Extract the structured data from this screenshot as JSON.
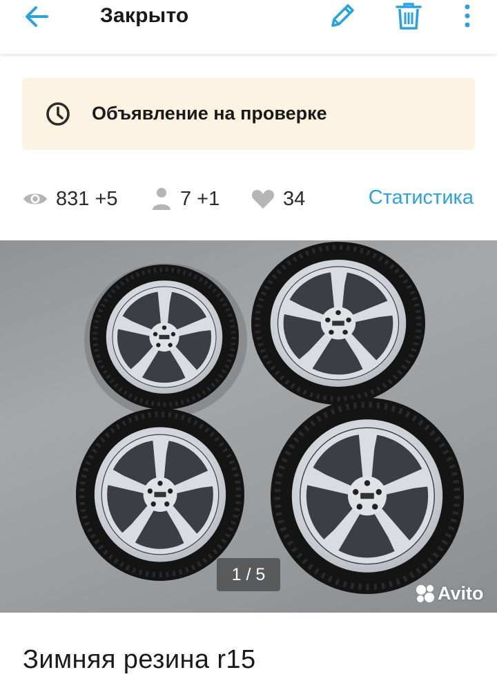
{
  "header": {
    "title": "Закрыто",
    "icons": {
      "back": "arrow-left-icon",
      "edit": "pencil-icon",
      "delete": "trash-icon",
      "more": "more-vertical-icon"
    },
    "icon_color": "#2aa1e0"
  },
  "moderation": {
    "text": "Объявление на проверке",
    "icon": "clock-icon",
    "background": "#fdf3e2"
  },
  "stats": {
    "views": "831 +5",
    "contacts": "7 +1",
    "favorites": "34",
    "link_label": "Статистика",
    "link_color": "#2aa1e0"
  },
  "gallery": {
    "counter": "1 / 5",
    "watermark": "Avito"
  },
  "listing": {
    "title": "Зимняя резина r15"
  }
}
